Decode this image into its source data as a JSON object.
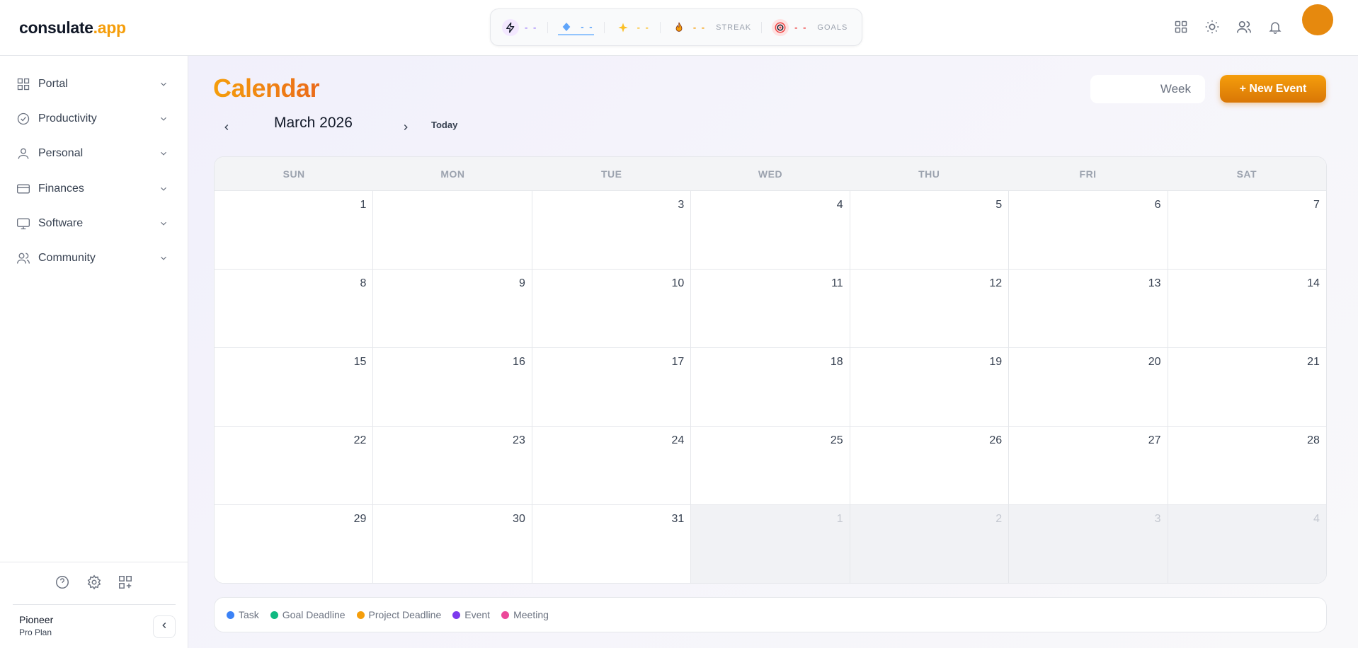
{
  "app": {
    "logo_main": "consulate",
    "logo_accent": ".app"
  },
  "stats": [
    {
      "icon": "lightning-icon",
      "value": "- -",
      "label": "",
      "color": "#a78bfa"
    },
    {
      "icon": "diamond-icon",
      "value": "- -",
      "label": "",
      "color": "#60a5fa"
    },
    {
      "icon": "sparkle-icon",
      "value": "- -",
      "label": "",
      "color": "#fbbf24"
    },
    {
      "icon": "flame-icon",
      "value": "- -",
      "label": "STREAK",
      "color": "#f59e0b"
    },
    {
      "icon": "target-icon",
      "value": "- -",
      "label": "GOALS",
      "color": "#ef4444"
    }
  ],
  "top_actions": [
    "apps-grid-icon",
    "sun-icon",
    "users-icon",
    "bell-icon"
  ],
  "sidebar": {
    "items": [
      {
        "label": "Portal",
        "icon": "grid-icon"
      },
      {
        "label": "Productivity",
        "icon": "check-circle-icon"
      },
      {
        "label": "Personal",
        "icon": "user-icon"
      },
      {
        "label": "Finances",
        "icon": "credit-card-icon"
      },
      {
        "label": "Software",
        "icon": "monitor-icon"
      },
      {
        "label": "Community",
        "icon": "users-icon"
      }
    ],
    "utilities": [
      "help-icon",
      "settings-icon",
      "add-widget-icon"
    ],
    "plan": {
      "name": "Pioneer",
      "tier": "Pro Plan"
    }
  },
  "main": {
    "title": "Calendar",
    "month_label": "March 2026",
    "today_label": "Today",
    "view_label": "Week",
    "new_event_label": "+ New Event"
  },
  "calendar": {
    "weekdays": [
      "SUN",
      "MON",
      "TUE",
      "WED",
      "THU",
      "FRI",
      "SAT"
    ],
    "weeks": [
      [
        {
          "d": "1",
          "o": false
        },
        {
          "d": "",
          "o": false
        },
        {
          "d": "3",
          "o": false
        },
        {
          "d": "4",
          "o": false
        },
        {
          "d": "5",
          "o": false
        },
        {
          "d": "6",
          "o": false
        },
        {
          "d": "7",
          "o": false
        }
      ],
      [
        {
          "d": "8",
          "o": false
        },
        {
          "d": "9",
          "o": false
        },
        {
          "d": "10",
          "o": false
        },
        {
          "d": "11",
          "o": false
        },
        {
          "d": "12",
          "o": false
        },
        {
          "d": "13",
          "o": false
        },
        {
          "d": "14",
          "o": false
        }
      ],
      [
        {
          "d": "15",
          "o": false
        },
        {
          "d": "16",
          "o": false
        },
        {
          "d": "17",
          "o": false
        },
        {
          "d": "18",
          "o": false
        },
        {
          "d": "19",
          "o": false
        },
        {
          "d": "20",
          "o": false
        },
        {
          "d": "21",
          "o": false
        }
      ],
      [
        {
          "d": "22",
          "o": false
        },
        {
          "d": "23",
          "o": false
        },
        {
          "d": "24",
          "o": false
        },
        {
          "d": "25",
          "o": false
        },
        {
          "d": "26",
          "o": false
        },
        {
          "d": "27",
          "o": false
        },
        {
          "d": "28",
          "o": false
        }
      ],
      [
        {
          "d": "29",
          "o": false
        },
        {
          "d": "30",
          "o": false
        },
        {
          "d": "31",
          "o": false
        },
        {
          "d": "1",
          "o": true
        },
        {
          "d": "2",
          "o": true
        },
        {
          "d": "3",
          "o": true
        },
        {
          "d": "4",
          "o": true
        }
      ]
    ]
  },
  "legend": [
    {
      "label": "Task",
      "color": "#3b82f6"
    },
    {
      "label": "Goal Deadline",
      "color": "#10b981"
    },
    {
      "label": "Project Deadline",
      "color": "#f59e0b"
    },
    {
      "label": "Event",
      "color": "#7c3aed"
    },
    {
      "label": "Meeting",
      "color": "#ec4899"
    }
  ]
}
